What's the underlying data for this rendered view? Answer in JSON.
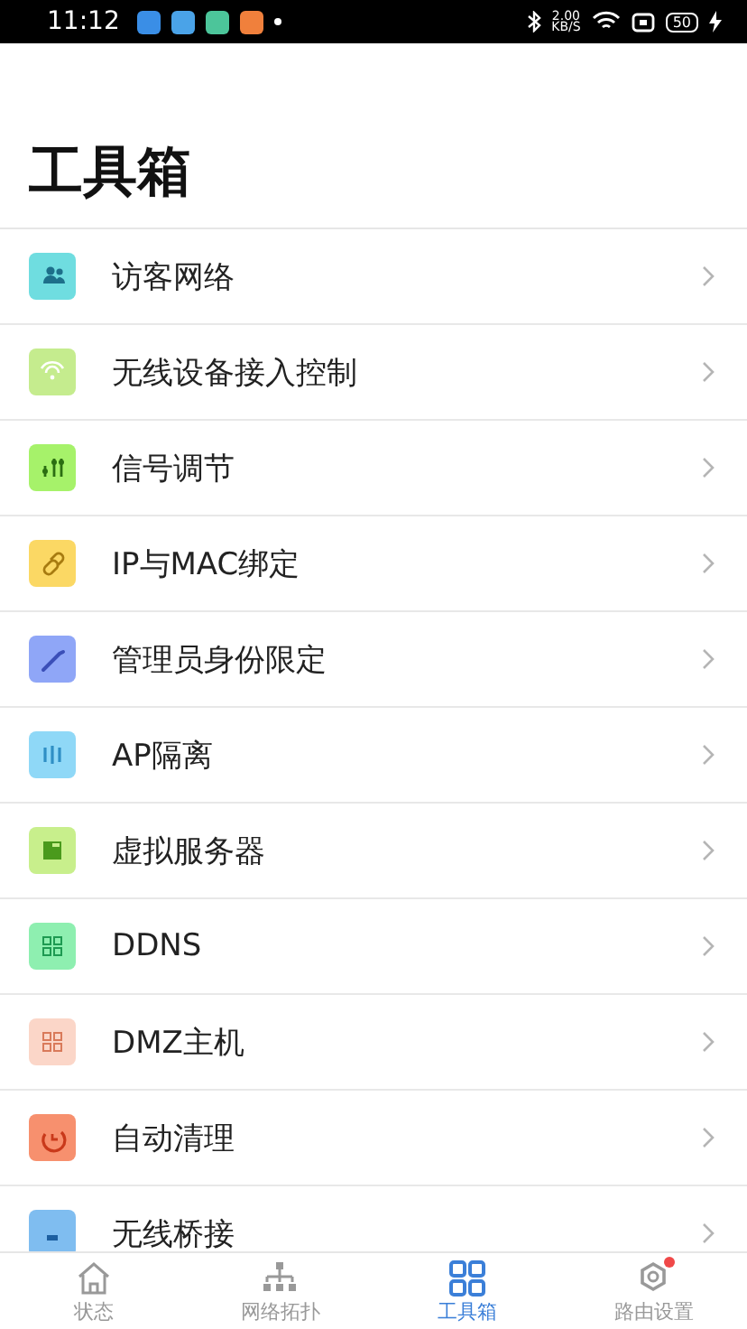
{
  "status_bar": {
    "time": "11:12",
    "notifications": [
      {
        "color": "#3a8ee6"
      },
      {
        "color": "#4aa3e8"
      },
      {
        "color": "#4cc59a"
      },
      {
        "color": "#f0803c"
      }
    ],
    "speed_value": "2.00",
    "speed_unit": "KB/S",
    "battery": "50"
  },
  "title": "工具箱",
  "tools": [
    {
      "label": "访客网络",
      "kind": "guests",
      "color": "#6fdde0"
    },
    {
      "label": "无线设备接入控制",
      "kind": "wifi",
      "color": "#c5ec8e"
    },
    {
      "label": "信号调节",
      "kind": "sliders",
      "color": "#a6f26a"
    },
    {
      "label": "IP与MAC绑定",
      "kind": "link",
      "color": "#fbd864"
    },
    {
      "label": "管理员身份限定",
      "kind": "wrench",
      "color": "#8fa6f7"
    },
    {
      "label": "AP隔离",
      "kind": "bars",
      "color": "#8fd8f7"
    },
    {
      "label": "虚拟服务器",
      "kind": "server",
      "color": "#c8ef8c"
    },
    {
      "label": "DDNS",
      "kind": "ddns",
      "color": "#8eefb0"
    },
    {
      "label": "DMZ主机",
      "kind": "dmz",
      "color": "#fbd6c8"
    },
    {
      "label": "自动清理",
      "kind": "clean",
      "color": "#f7906e"
    },
    {
      "label": "无线桥接",
      "kind": "bridge",
      "color": "#7fbdf0"
    }
  ],
  "nav": [
    {
      "label": "状态",
      "kind": "home",
      "selected": false,
      "badge": false
    },
    {
      "label": "网络拓扑",
      "kind": "topology",
      "selected": false,
      "badge": false
    },
    {
      "label": "工具箱",
      "kind": "grid",
      "selected": true,
      "badge": false
    },
    {
      "label": "路由设置",
      "kind": "gear",
      "selected": false,
      "badge": true
    }
  ]
}
